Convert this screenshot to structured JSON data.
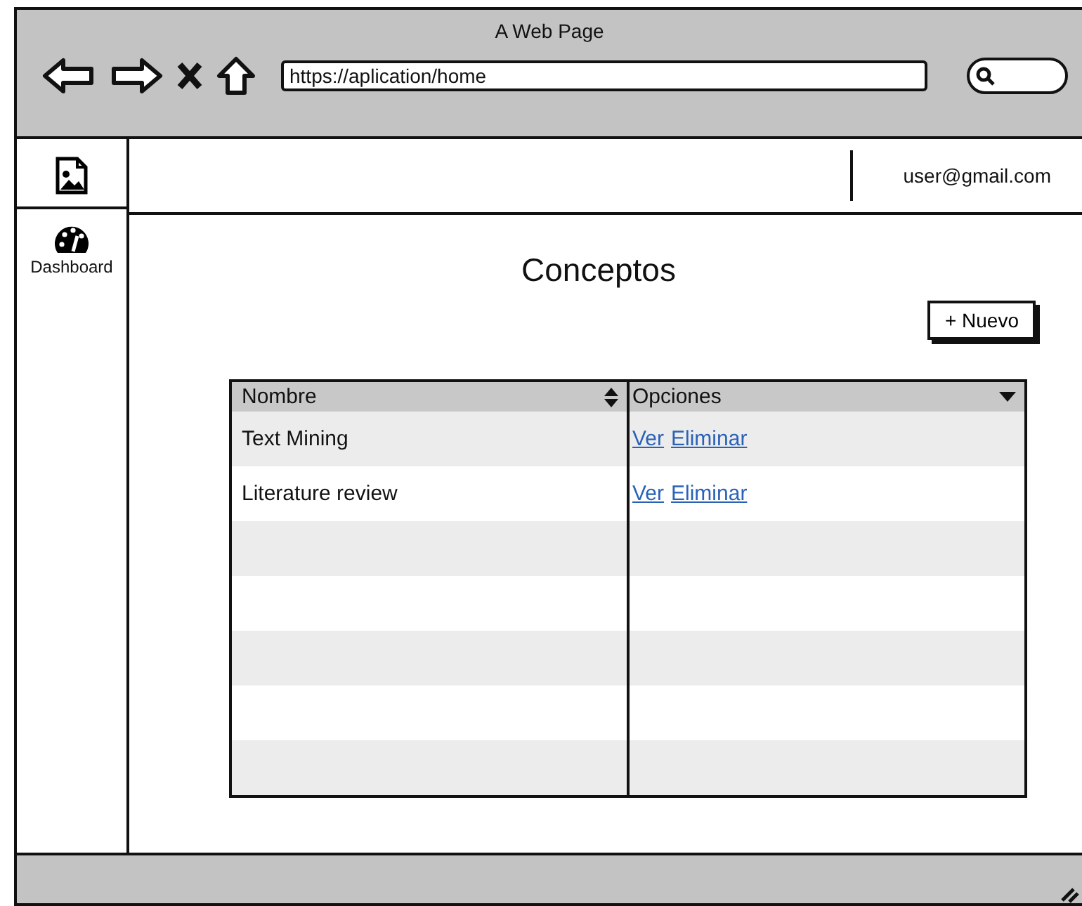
{
  "window": {
    "title": "A Web Page",
    "url": "https://aplication/home"
  },
  "sidebar": {
    "items": [
      {
        "kind": "image"
      },
      {
        "kind": "gauge",
        "label": "Dashboard"
      }
    ]
  },
  "topbar": {
    "user": "user@gmail.com"
  },
  "page": {
    "title": "Conceptos",
    "new_button": "+ Nuevo"
  },
  "table": {
    "columns": [
      {
        "label": "Nombre",
        "kind": "sort"
      },
      {
        "label": "Opciones",
        "kind": "menu"
      }
    ],
    "rows": [
      {
        "name": "Text Mining",
        "actions": [
          "Ver",
          "Eliminar"
        ]
      },
      {
        "name": "Literature review",
        "actions": [
          "Ver",
          "Eliminar"
        ]
      }
    ]
  }
}
